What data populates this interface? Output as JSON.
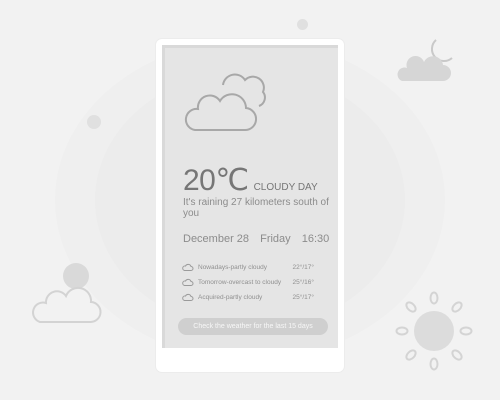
{
  "weather": {
    "temperature": "20℃",
    "condition": "CLOUDY DAY",
    "description": "It's raining 27 kilometers south of you",
    "date": "December 28",
    "weekday": "Friday",
    "time": "16:30",
    "icon": "cloud-icon"
  },
  "forecast": [
    {
      "label": "Nowadays-partly cloudy",
      "temp": "22°/17°",
      "icon": "small-cloud-icon"
    },
    {
      "label": "Tomorrow-overcast to cloudy",
      "temp": "25°/16°",
      "icon": "small-cloud-icon"
    },
    {
      "label": "Acquired-partly cloudy",
      "temp": "25°/17°",
      "icon": "small-cloud-icon"
    }
  ],
  "history_button": {
    "label": "Check the weather for the last 15 days"
  },
  "colors": {
    "background": "#f2f2f2",
    "screen": "#e5e5e5",
    "text_primary": "#767676",
    "text_secondary": "#8c8c8c",
    "button": "#cfcfcf",
    "icon_stroke": "#9a9a9a"
  },
  "decor_icons": [
    "moon-cloud-icon",
    "sun-cloud-icon",
    "cloud-outline-icon",
    "sun-icon"
  ]
}
